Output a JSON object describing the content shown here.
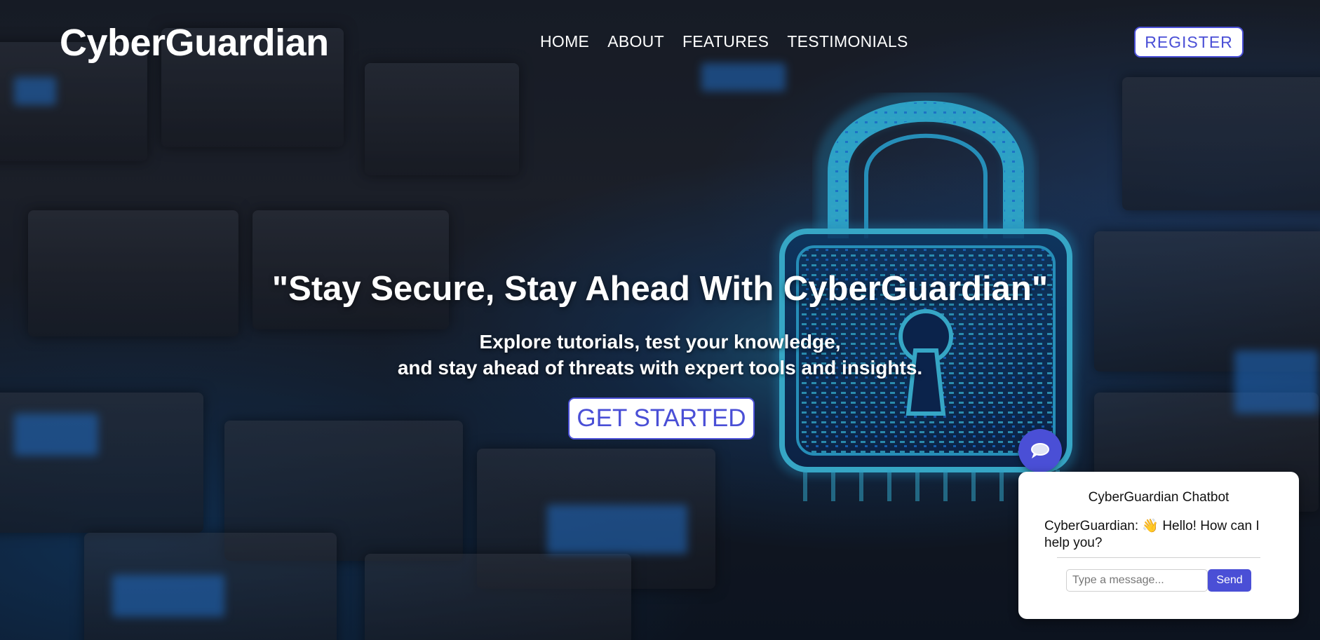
{
  "header": {
    "logo": "CyberGuardian",
    "nav": [
      {
        "label": "HOME"
      },
      {
        "label": "ABOUT"
      },
      {
        "label": "FEATURES"
      },
      {
        "label": "TESTIMONIALS"
      }
    ],
    "register_label": "REGISTER"
  },
  "hero": {
    "title": "\"Stay Secure, Stay Ahead With CyberGuardian\"",
    "subtitle_line1": "Explore tutorials, test your knowledge,",
    "subtitle_line2": "and stay ahead of threats with expert tools and insights.",
    "cta_label": "GET STARTED"
  },
  "chatbot": {
    "toggle_icon": "chat-bubble-icon",
    "title": "CyberGuardian Chatbot",
    "message": "CyberGuardian: 👋 Hello! How can I help you?",
    "input_placeholder": "Type a message...",
    "send_label": "Send"
  },
  "colors": {
    "accent": "#4a4fd6",
    "text_light": "#ffffff",
    "glow": "#28aae6"
  }
}
